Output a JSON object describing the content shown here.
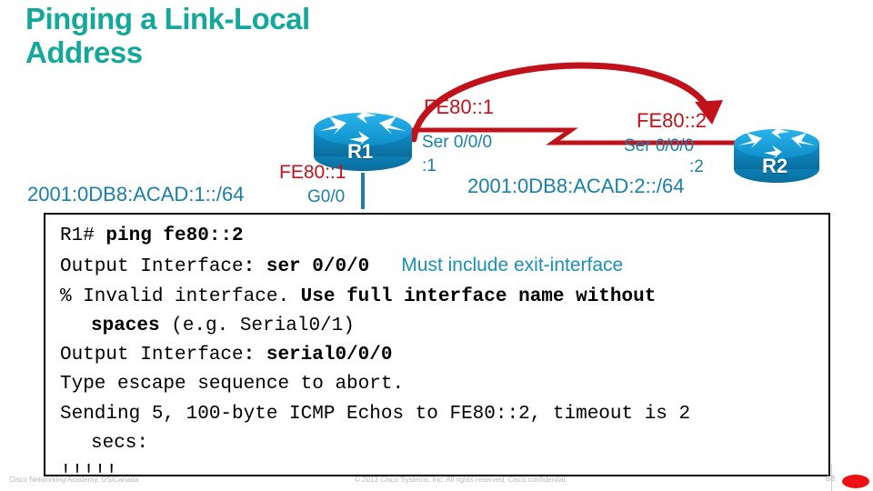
{
  "slide": {
    "title": "Pinging a Link-Local\nAddress"
  },
  "diagram": {
    "left_network": "2001:0DB8:ACAD:1::/64",
    "right_network": "2001:0DB8:ACAD:2::/64",
    "routers": [
      {
        "name": "R1",
        "icon": "router-icon"
      },
      {
        "name": "R2",
        "icon": "router-icon"
      }
    ],
    "r1_lan_linklocal": "FE80::1",
    "r1_lan_interface": "G0/0",
    "r1_wan_linklocal": "FE80::1",
    "r1_wan_interface": "Ser 0/0/0",
    "r1_wan_hostid": ":1",
    "r2_wan_linklocal": "FE80::2",
    "r2_wan_interface": "Ser 0/0/0",
    "r2_wan_hostid": ":2",
    "arrow": "curved-ping-arrow",
    "serial_link": "serial-wan-link"
  },
  "console": {
    "lines": [
      {
        "parts": [
          {
            "t": "R1# ",
            "b": false
          },
          {
            "t": "ping fe80::2",
            "b": true
          }
        ],
        "indent": false,
        "annot": ""
      },
      {
        "parts": [
          {
            "t": "Output Interface",
            "b": false
          },
          {
            "t": ": ser 0/0/0",
            "b": true
          }
        ],
        "indent": false,
        "annot": "Must include exit-interface"
      },
      {
        "parts": [
          {
            "t": "% Invalid interface. ",
            "b": false
          },
          {
            "t": "Use full interface name without",
            "b": true
          }
        ],
        "indent": false,
        "annot": ""
      },
      {
        "parts": [
          {
            "t": "spaces ",
            "b": true
          },
          {
            "t": "(e.g. Serial0/1)",
            "b": false
          }
        ],
        "indent": true,
        "annot": ""
      },
      {
        "parts": [
          {
            "t": "Output Interface",
            "b": false
          },
          {
            "t": ": serial0/0/0",
            "b": true
          }
        ],
        "indent": false,
        "annot": ""
      },
      {
        "parts": [
          {
            "t": "Type escape sequence to abort.",
            "b": false
          }
        ],
        "indent": false,
        "annot": ""
      },
      {
        "parts": [
          {
            "t": "Sending 5, 100-byte ICMP Echos to FE80::2, timeout is 2",
            "b": false
          }
        ],
        "indent": false,
        "annot": ""
      },
      {
        "parts": [
          {
            "t": "secs:",
            "b": false
          }
        ],
        "indent": true,
        "annot": ""
      },
      {
        "parts": [
          {
            "t": "!!!!!",
            "b": false
          }
        ],
        "indent": false,
        "annot": ""
      }
    ]
  },
  "footer": {
    "left": "Cisco Networking Academy, US/Canada",
    "copyright": "© 2013 Cisco Systems, Inc. All rights reserved. Cisco confidential.",
    "page_number": "63"
  },
  "colors": {
    "title_teal": "#14a79c",
    "label_red": "#c1121c",
    "label_teal": "#1a7fa8",
    "annot_blue": "#1a8fb8",
    "router_blue": "#1799d6",
    "router_blue_dark": "#0d7aad",
    "accent_red": "#ee1111"
  }
}
